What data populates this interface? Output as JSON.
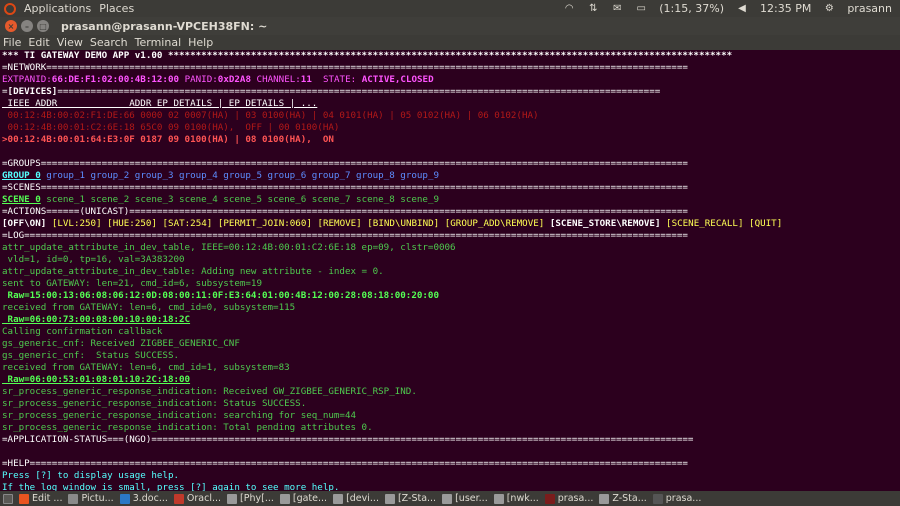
{
  "panel": {
    "applications": "Applications",
    "places": "Places",
    "battery": "(1:15, 37%)",
    "clock": "12:35 PM",
    "user": "prasann"
  },
  "window": {
    "title": "prasann@prasann-VPCEH38FN: ~"
  },
  "menu": [
    "File",
    "Edit",
    "View",
    "Search",
    "Terminal",
    "Help"
  ],
  "terminal": {
    "header": "*** TI GATEWAY DEMO APP v1.00 ******************************************************************************************************",
    "network_sep": "=NETWORK====================================================================================================================",
    "network": {
      "extpanid_label": "EXTPANID:",
      "extpanid": "66:DE:F1:02:00:4B:12:00",
      "panid_label": "PANID:",
      "panid": "0xD2A8",
      "channel_label": "CHANNEL:",
      "channel": "11",
      "state_label": "STATE:",
      "state": "ACTIVE,CLOSED"
    },
    "devices_sep_pre": "=",
    "devices_title": "[DEVICES]",
    "devices_sep_post": "=============================================================================================================",
    "devices_header": " IEEE_ADDR             ADDR EP DETAILS | EP DETAILS | ...",
    "devices": [
      {
        "text": " 00:12:4B:00:02:F1:DE:66 0000 02 0007(HA) | 03 0100(HA) | 04 0101(HA) | 05 0102(HA) | 06 0102(HA)",
        "cls": "r"
      },
      {
        "text": " 00:12:4B:00:01:C2:6E:18 65C0 09 0100(HA),  OFF | 00 0100(HA)",
        "cls": "r"
      },
      {
        "text": ">00:12:4B:00:01:64:E3:0F 0187 09 0100(HA) | 08 0100(HA),  ON",
        "cls": "rb"
      }
    ],
    "groups_sep": "=GROUPS=====================================================================================================================",
    "groups_selected": "GROUP_0",
    "groups": "group_1 group_2 group_3 group_4 group_5 group_6 group_7 group_8 group_9",
    "scenes_sep": "=SCENES=====================================================================================================================",
    "scenes_selected": "SCENE_0",
    "scenes": "scene_1 scene_2 scene_3 scene_4 scene_5 scene_6 scene_7 scene_8 scene_9",
    "actions_sep": "=ACTIONS======(UNICAST)=====================================================================================================",
    "actions": [
      "[OFF\\ON]",
      "[LVL:250]",
      "[HUE:250]",
      "[SAT:254]",
      "[PERMIT_JOIN:060]",
      "[REMOVE]",
      "[BIND\\UNBIND]",
      "[GROUP_ADD\\REMOVE]",
      "[SCENE_STORE\\REMOVE]",
      "[SCENE_RECALL]",
      "[QUIT]"
    ],
    "log_sep": "=LOG========================================================================================================================",
    "log": [
      {
        "text": "attr_update_attribute_in_dev_table, IEEE=00:12:4B:00:01:C2:6E:18 ep=09, clstr=0006",
        "cls": "g"
      },
      {
        "text": " vld=1, id=0, tp=16, val=3A383200",
        "cls": "g"
      },
      {
        "text": "attr_update_attribute_in_dev_table: Adding new attribute - index = 0.",
        "cls": "g"
      },
      {
        "text": "sent to GATEWAY: len=21, cmd_id=6, subsystem=19",
        "cls": "g"
      },
      {
        "text": " Raw=15:00:13:06:08:06:12:0D:08:00:11:0F:E3:64:01:00:4B:12:00:28:08:18:00:20:00",
        "cls": "gb"
      },
      {
        "text": "received from GATEWAY: len=6, cmd_id=0, subsystem=115",
        "cls": "g"
      },
      {
        "text": " Raw=06:00:73:00:08:00:10:00:18:2C",
        "cls": "gb u"
      },
      {
        "text": "Calling confirmation callback",
        "cls": "g"
      },
      {
        "text": "gs_generic_cnf: Received ZIGBEE_GENERIC_CNF",
        "cls": "g"
      },
      {
        "text": "gs_generic_cnf:  Status SUCCESS.",
        "cls": "g"
      },
      {
        "text": "received from GATEWAY: len=6, cmd_id=1, subsystem=83",
        "cls": "g"
      },
      {
        "text": " Raw=06:00:53:01:08:01:10:2C:18:00",
        "cls": "gb u"
      },
      {
        "text": "sr_process_generic_response_indication: Received GW_ZIGBEE_GENERIC_RSP_IND.",
        "cls": "g"
      },
      {
        "text": "sr_process_generic_response_indication: Status SUCCESS.",
        "cls": "g"
      },
      {
        "text": "sr_process_generic_response_indication: searching for seq_num=44",
        "cls": "g"
      },
      {
        "text": "sr_process_generic_response_indication: Total pending attributes 0.",
        "cls": "g"
      }
    ],
    "app_status_sep": "=APPLICATION-STATUS===(NGO)==================================================================================================",
    "help_sep": "=HELP=======================================================================================================================",
    "help": [
      "Press [?] to display usage help.",
      "If the log window is small, press [?] again to see more help."
    ]
  },
  "taskbar": [
    {
      "label": "Edit ...",
      "color": "#e95420"
    },
    {
      "label": "Pictu...",
      "color": "#8a8a8a"
    },
    {
      "label": "3.doc...",
      "color": "#2b78c5"
    },
    {
      "label": "Oracl...",
      "color": "#c0392b"
    },
    {
      "label": "[Phy[...",
      "color": "#9a9a9a"
    },
    {
      "label": "[gate...",
      "color": "#9a9a9a"
    },
    {
      "label": "[devi...",
      "color": "#9a9a9a"
    },
    {
      "label": "[Z-Sta...",
      "color": "#9a9a9a"
    },
    {
      "label": "[user...",
      "color": "#9a9a9a"
    },
    {
      "label": "[nwk...",
      "color": "#9a9a9a"
    },
    {
      "label": "prasa...",
      "color": "#7a1c1c"
    },
    {
      "label": "Z-Sta...",
      "color": "#9a9a9a"
    },
    {
      "label": "prasa...",
      "color": "#555555"
    }
  ]
}
